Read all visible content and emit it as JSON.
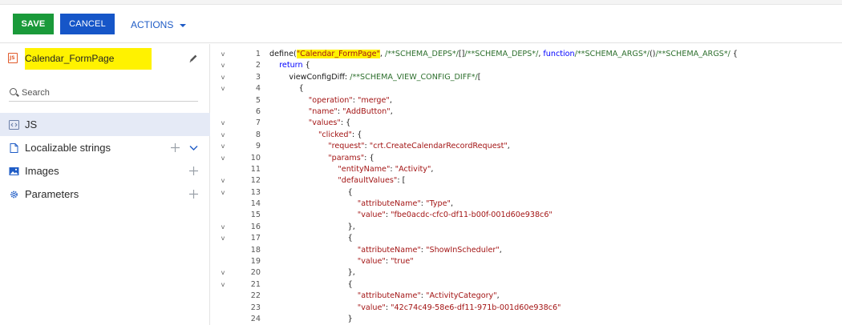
{
  "toolbar": {
    "save_label": "SAVE",
    "cancel_label": "CANCEL",
    "actions_label": "ACTIONS"
  },
  "sidebar": {
    "title": "Calendar_FormPage",
    "search_placeholder": "Search",
    "items": [
      {
        "label": "JS",
        "icon": "code-file-icon",
        "active": true
      },
      {
        "label": "Localizable strings",
        "icon": "document-icon"
      },
      {
        "label": "Images",
        "icon": "image-icon"
      },
      {
        "label": "Parameters",
        "icon": "gear-icon"
      }
    ]
  },
  "editor": {
    "line_numbers": [
      "1",
      "2",
      "3",
      "4",
      "5",
      "6",
      "7",
      "8",
      "9",
      "10",
      "11",
      "12",
      "13",
      "14",
      "15",
      "16",
      "17",
      "18",
      "19",
      "20",
      "21",
      "22",
      "23",
      "24"
    ],
    "fold_markers": [
      "v",
      "v",
      "v",
      "v",
      "",
      "",
      "v",
      "v",
      "v",
      "v",
      "",
      "v",
      "v",
      "",
      "",
      "v",
      "v",
      "",
      "",
      "v",
      "v",
      "",
      "",
      ""
    ],
    "lines": [
      [
        "define(",
        "\"Calendar_FormPage\"",
        ", /**SCHEMA_DEPS*/[]/**SCHEMA_DEPS*/, function/**SCHEMA_ARGS*/()/**SCHEMA_ARGS*/ {"
      ],
      [
        "    return {"
      ],
      [
        "        viewConfigDiff: /**SCHEMA_VIEW_CONFIG_DIFF*/["
      ],
      [
        "            {"
      ],
      [
        "                \"operation\": \"merge\","
      ],
      [
        "                \"name\": \"AddButton\","
      ],
      [
        "                \"values\": {"
      ],
      [
        "                    \"clicked\": {"
      ],
      [
        "                        \"request\": \"crt.CreateCalendarRecordRequest\","
      ],
      [
        "                        \"params\": {"
      ],
      [
        "                            \"entityName\": \"Activity\","
      ],
      [
        "                            \"defaultValues\": ["
      ],
      [
        "                                {"
      ],
      [
        "                                    \"attributeName\": \"Type\","
      ],
      [
        "                                    \"value\": \"fbe0acdc-cfc0-df11-b00f-001d60e938c6\""
      ],
      [
        "                                },"
      ],
      [
        "                                {"
      ],
      [
        "                                    \"attributeName\": \"ShowInScheduler\","
      ],
      [
        "                                    \"value\": \"true\""
      ],
      [
        "                                },"
      ],
      [
        "                                {"
      ],
      [
        "                                    \"attributeName\": \"ActivityCategory\","
      ],
      [
        "                                    \"value\": \"42c74c49-58e6-df11-971b-001d60e938c6\""
      ],
      [
        "                                }"
      ]
    ]
  }
}
